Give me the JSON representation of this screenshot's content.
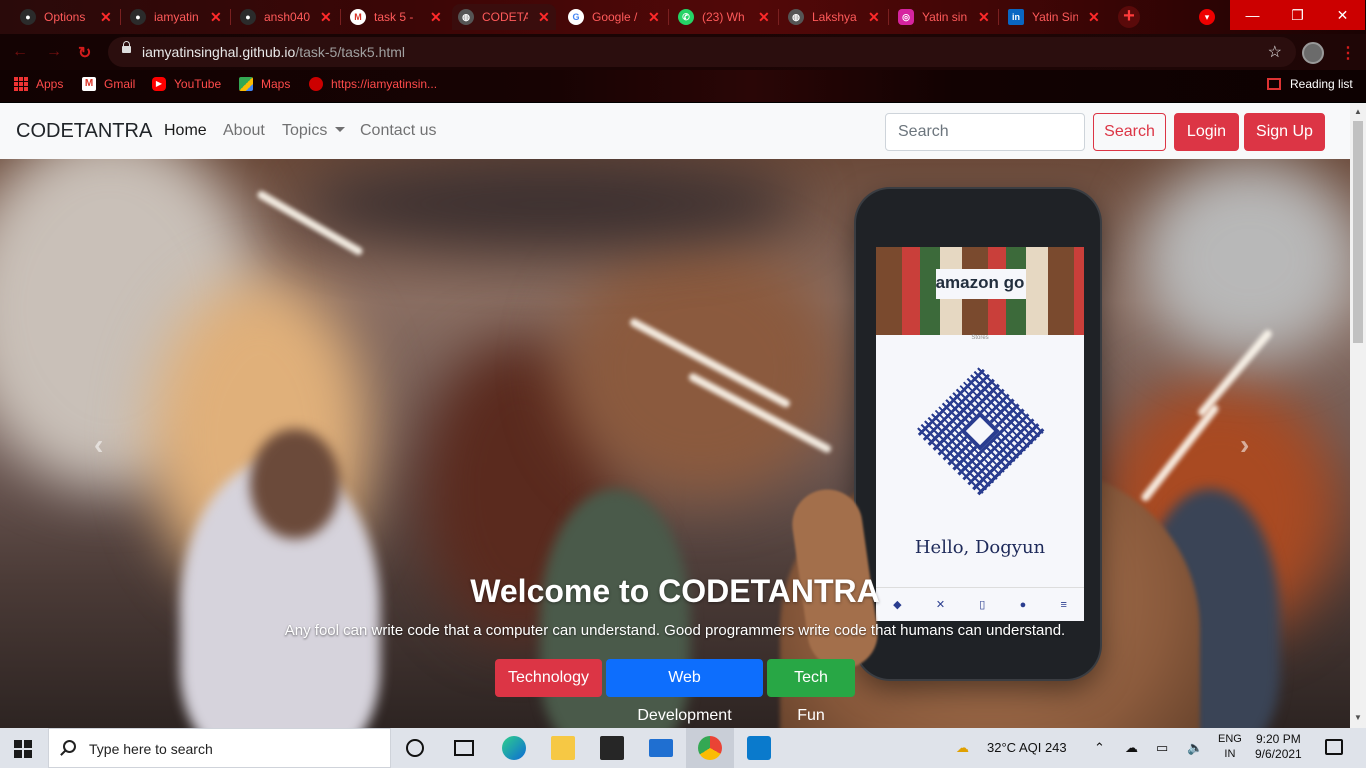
{
  "browser": {
    "tabs": [
      {
        "title": "Options",
        "icon": "github-icon",
        "color": "#2b2b2b"
      },
      {
        "title": "iamyatin",
        "icon": "github-icon",
        "color": "#2b2b2b"
      },
      {
        "title": "ansh040",
        "icon": "github-icon",
        "color": "#2b2b2b"
      },
      {
        "title": "task 5 -",
        "icon": "gmail-icon",
        "color": "#ffffff"
      },
      {
        "title": "CODETA",
        "icon": "globe-icon",
        "color": "#555555"
      },
      {
        "title": "Google /",
        "icon": "google-icon",
        "color": "#ffffff"
      },
      {
        "title": "(23) Wh",
        "icon": "whatsapp-icon",
        "color": "#25d366"
      },
      {
        "title": "Lakshya",
        "icon": "globe-icon",
        "color": "#555555"
      },
      {
        "title": "Yatin sin",
        "icon": "instagram-icon",
        "color": "#d6249f"
      },
      {
        "title": "Yatin Sin",
        "icon": "linkedin-icon",
        "color": "#0a66c2"
      }
    ],
    "url_host": "iamyatinsinghal.github.io",
    "url_path": "/task-5/task5.html",
    "bookmarks": [
      {
        "label": "Apps",
        "icon": "apps-icon"
      },
      {
        "label": "Gmail",
        "icon": "gmail-icon"
      },
      {
        "label": "YouTube",
        "icon": "youtube-icon"
      },
      {
        "label": "Maps",
        "icon": "maps-icon"
      },
      {
        "label": "https://iamyatinsin...",
        "icon": "globe-icon"
      }
    ],
    "reading_list": "Reading list"
  },
  "site": {
    "brand": "CODETANTRA",
    "nav": {
      "home": "Home",
      "about": "About",
      "topics": "Topics",
      "contact": "Contact us"
    },
    "search_placeholder": "Search",
    "search_button": "Search",
    "login": "Login",
    "signup": "Sign Up",
    "accent": "#dc3545"
  },
  "carousel": {
    "screen_brand": "amazon go",
    "screen_stores": "Stores",
    "screen_greeting": "Hello, Dogyun",
    "heading": "Welcome to CODETANTRA",
    "text": "Any fool can write code that a computer can understand. Good programmers write code that humans can understand.",
    "buttons": {
      "technology": "Technology",
      "webdev": "Web Development",
      "techfun": "Tech Fun"
    }
  },
  "taskbar": {
    "search_text": "Type here to search",
    "weather": "32°C  AQI 243",
    "lang_top": "ENG",
    "lang_bottom": "IN",
    "time": "9:20 PM",
    "date": "9/6/2021"
  }
}
